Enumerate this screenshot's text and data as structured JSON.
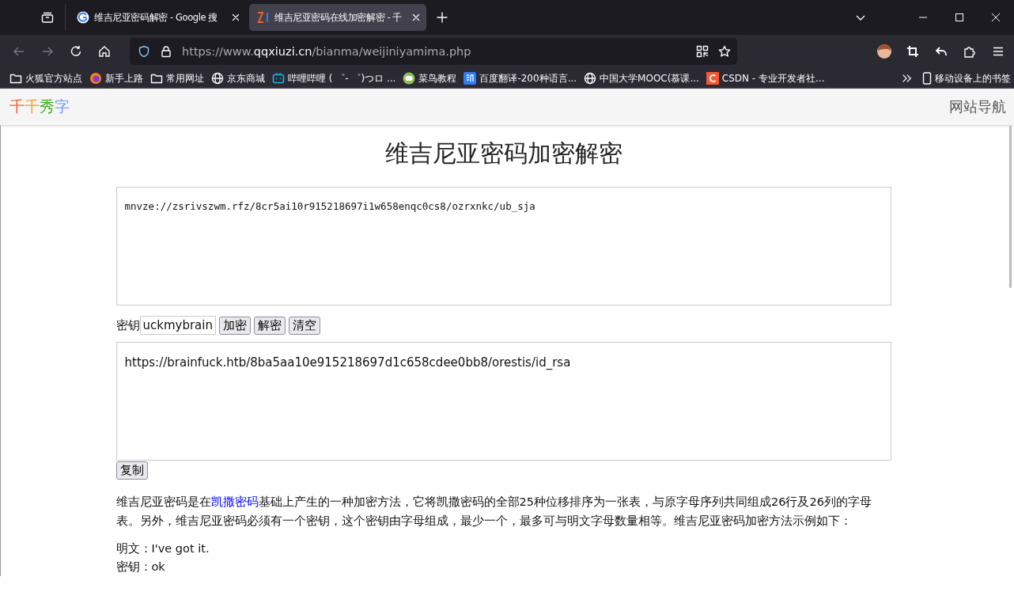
{
  "tabs": [
    {
      "title": "维吉尼亚密码解密 - Google 搜",
      "selected": false
    },
    {
      "title": "维吉尼亚密码在线加密解密 - 千",
      "selected": true
    }
  ],
  "address": {
    "prefix": "https://www.",
    "domain": "qqxiuzi.cn",
    "path": "/bianma/weijiniyamima.php"
  },
  "bookmarks": [
    "火狐官方站点",
    "新手上路",
    "常用网址",
    "京东商城",
    "哔哩哔哩 ( ゜- ゜)つロ ...",
    "菜鸟教程",
    "百度翻译-200种语言...",
    "中国大学MOOC(慕课...",
    "CSDN - 专业开发者社..."
  ],
  "mobile_bookmarks": "移动设备上的书签",
  "site": {
    "logo": [
      {
        "char": "千",
        "color": "#ff5a2a"
      },
      {
        "char": "千",
        "color": "#f0a020"
      },
      {
        "char": "秀",
        "color": "#33aa11"
      },
      {
        "char": "字",
        "color": "#6699ff"
      }
    ],
    "nav": "网站导航"
  },
  "heading": "维吉尼亚密码加密解密",
  "input_text": "mnvze://zsrivszwm.rfz/8cr5ai10r915218697i1w658enqc0cs8/ozrxnkc/ub_sja",
  "key_label": "密钥",
  "key_value": "uckmybrain",
  "buttons": [
    "加密",
    "解密",
    "清空"
  ],
  "output_text": "https://brainfuck.htb/8ba5aa10e915218697d1c658cdee0bb8/orestis/id_rsa",
  "copy_button": "复制",
  "description": {
    "before": "维吉尼亚密码是在",
    "link": "凯撒密码",
    "after": "基础上产生的一种加密方法，它将凯撒密码的全部25种位移排序为一张表，与原字母序列共同组成26行及26列的字母表。另外，维吉尼亚密码必须有一个密钥，这个密钥由字母组成，最少一个，最多可与明文字母数量相等。维吉尼亚密码加密方法示例如下："
  },
  "example": [
    "明文：I've got it.",
    "密钥：ok"
  ]
}
